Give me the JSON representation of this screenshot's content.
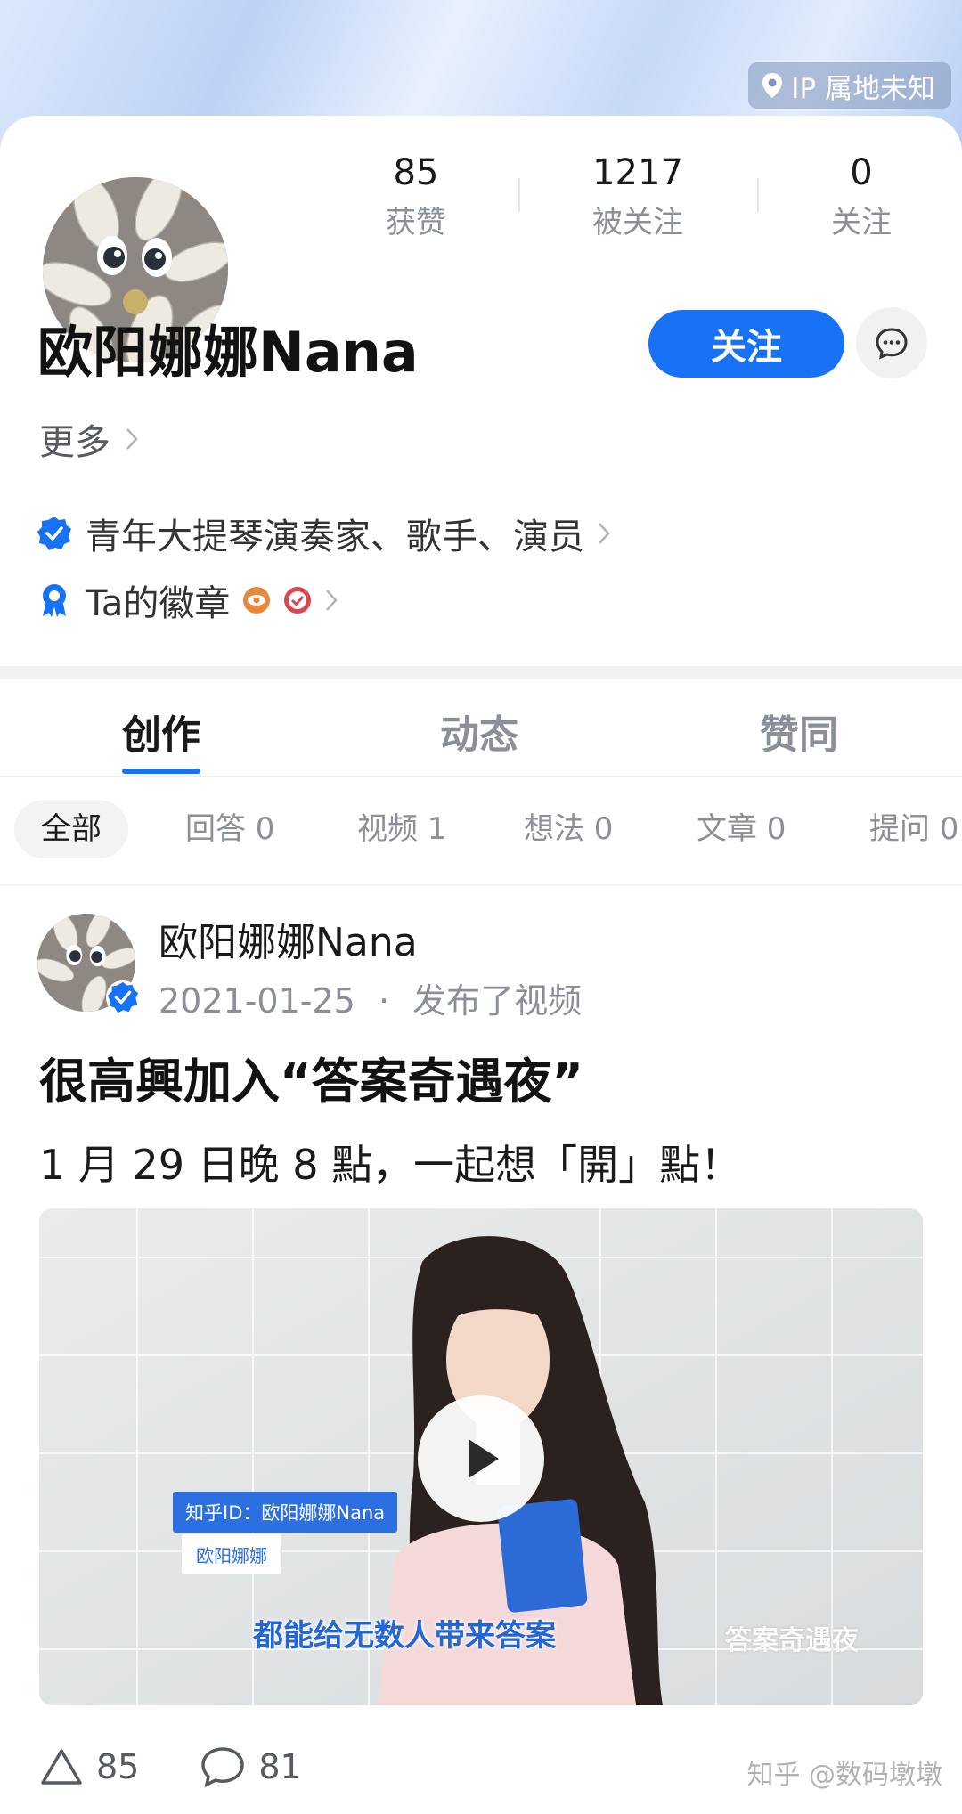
{
  "header": {
    "ip_location": "IP 属地未知",
    "ip_icon": "location-pin-icon"
  },
  "profile": {
    "name": "欧阳娜娜Nana",
    "stats": [
      {
        "value": "85",
        "label": "获赞"
      },
      {
        "value": "1217",
        "label": "被关注"
      },
      {
        "value": "0",
        "label": "关注"
      }
    ],
    "follow_label": "关注",
    "more_label": "更多",
    "verification": "青年大提琴演奏家、歌手、演员",
    "badges_label": "Ta的徽章"
  },
  "tabs": [
    {
      "label": "创作",
      "active": true
    },
    {
      "label": "动态",
      "active": false
    },
    {
      "label": "赞同",
      "active": false
    }
  ],
  "filters": [
    "全部",
    "回答 0",
    "视频 1",
    "想法 0",
    "文章 0",
    "提问 0"
  ],
  "post": {
    "author": "欧阳娜娜Nana",
    "date": "2021-01-25",
    "meta_sep": "·",
    "action": "发布了视频",
    "title": "很高興加入“答案奇遇夜”",
    "text": "1 月 29 日晚 8 點，一起想「開」點！",
    "video": {
      "tag_id": "知乎ID：欧阳娜娜Nana",
      "tag_name": "欧阳娜娜",
      "caption": "都能给无数人带来答案",
      "brand": "答案奇遇夜"
    },
    "likes": "85",
    "comments": "81"
  },
  "watermark": "知乎 @数码墩墩",
  "colors": {
    "accent": "#1772f6",
    "muted": "#8a8f99"
  }
}
